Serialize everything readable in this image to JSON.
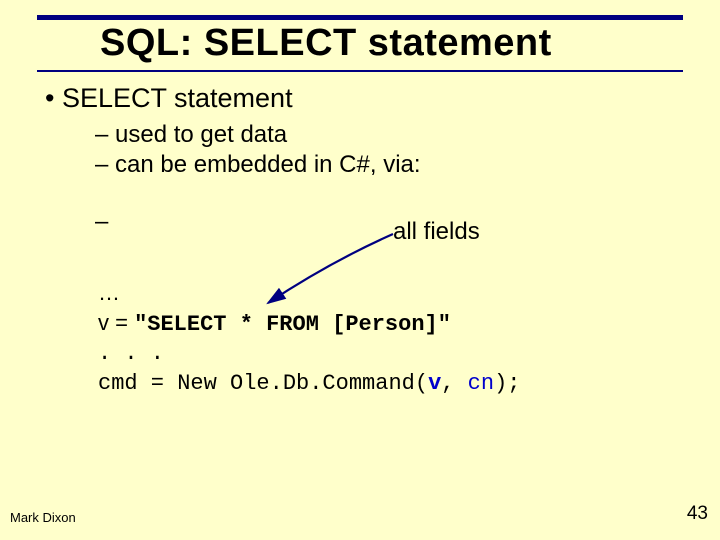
{
  "title": "SQL: SELECT statement",
  "bullets": {
    "lvl1": "SELECT statement",
    "lvl2a": "used to get data",
    "lvl2b": "can be embedded in C#, via:"
  },
  "dash": "–",
  "annotation": "all fields",
  "code": {
    "l1": "…",
    "l2a": "v = ",
    "l2b": "\"SELECT * FROM [Person]\"",
    "l3": ". . . ",
    "l4a": "cmd = New Ole.Db.Command(",
    "l4b": "v",
    "l4c": ", ",
    "l4d": "cn",
    "l4e": ");"
  },
  "footer": {
    "author": "Mark Dixon",
    "page": "43"
  }
}
